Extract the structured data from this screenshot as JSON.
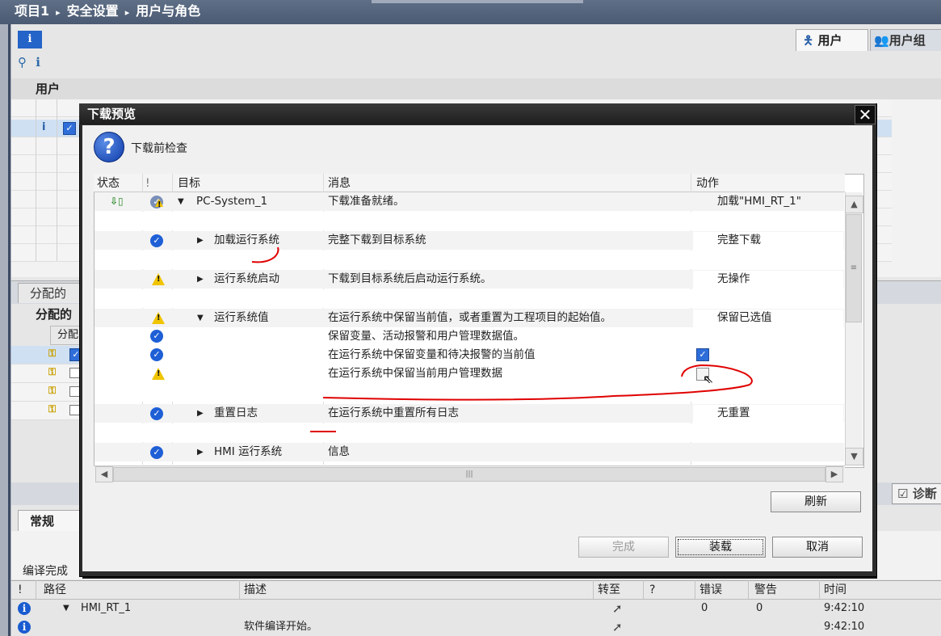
{
  "breadcrumb": [
    "项目1",
    "安全设置",
    "用户与角色"
  ],
  "breadcrumb_separator": "▸",
  "top_tabs": {
    "users": "用户",
    "user_groups": "用户组"
  },
  "info_badge": "i",
  "section_users": "用户",
  "assigned_tab": "分配的",
  "assigned_title": "分配的",
  "assigned_col": "分配",
  "diagnostics_tab": "诊断",
  "general_tab": "常规",
  "compile_status": "编译完成",
  "compile_table": {
    "headers": {
      "bang": "!",
      "path": "路径",
      "description": "描述",
      "goto": "转至",
      "q": "?",
      "errors": "错误",
      "warnings": "警告",
      "time": "时间"
    },
    "rows": [
      {
        "path": "HMI_RT_1",
        "description": "",
        "errors": "0",
        "warnings": "0",
        "time": "9:42:10"
      },
      {
        "path": "",
        "description": "软件编译开始。",
        "errors": "",
        "warnings": "",
        "time": "9:42:10"
      }
    ]
  },
  "dialog": {
    "title": "下载预览",
    "close": "✕",
    "subtitle": "下载前检查",
    "columns": {
      "status": "状态",
      "bang": "!",
      "target": "目标",
      "message": "消息",
      "action": "动作"
    },
    "rows": [
      {
        "target": "PC-System_1",
        "message": "下载准备就绪。",
        "action": "加载\"HMI_RT_1\""
      },
      {
        "target": "加载运行系统",
        "message": "完整下载到目标系统",
        "action": "完整下载"
      },
      {
        "target": "运行系统启动",
        "message": "下载到目标系统后启动运行系统。",
        "action": "无操作"
      },
      {
        "target": "运行系统值",
        "message": "在运行系统中保留当前值，或者重置为工程项目的起始值。",
        "action": "保留已选值"
      },
      {
        "target": "",
        "message": "保留变量、活动报警和用户管理数据值。",
        "action": ""
      },
      {
        "target": "",
        "message": "在运行系统中保留变量和待决报警的当前值",
        "action": ""
      },
      {
        "target": "",
        "message": "在运行系统中保留当前用户管理数据",
        "action": ""
      },
      {
        "target": "重置日志",
        "message": "在运行系统中重置所有日志",
        "action": "无重置"
      },
      {
        "target": "HMI 运行系统",
        "message": "信息",
        "action": ""
      }
    ],
    "buttons": {
      "refresh": "刷新",
      "finish": "完成",
      "load": "装载",
      "cancel": "取消"
    }
  },
  "colors": {
    "accent": "#1e5fd6",
    "titlebar": "#2c2c2c",
    "breadcrumb_bg": "#4f5f78",
    "annotation": "#e00000"
  }
}
